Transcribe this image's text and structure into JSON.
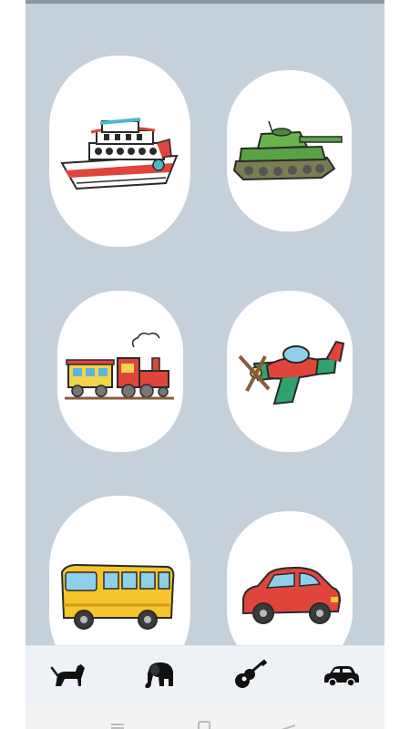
{
  "app": {
    "panel_color": "#c5d0db",
    "card_color": "#ffffff"
  },
  "cards": [
    {
      "icon": "ship-icon"
    },
    {
      "icon": "tank-icon"
    },
    {
      "icon": "train-icon"
    },
    {
      "icon": "airplane-icon"
    },
    {
      "icon": "bus-icon"
    },
    {
      "icon": "car-icon"
    }
  ],
  "bottom_nav": {
    "items": [
      {
        "icon": "dog-icon"
      },
      {
        "icon": "elephant-icon"
      },
      {
        "icon": "guitar-icon"
      },
      {
        "icon": "car-icon",
        "selected": true
      }
    ]
  },
  "system_nav": {
    "items": [
      "menu-icon",
      "home-icon",
      "back-icon"
    ]
  }
}
